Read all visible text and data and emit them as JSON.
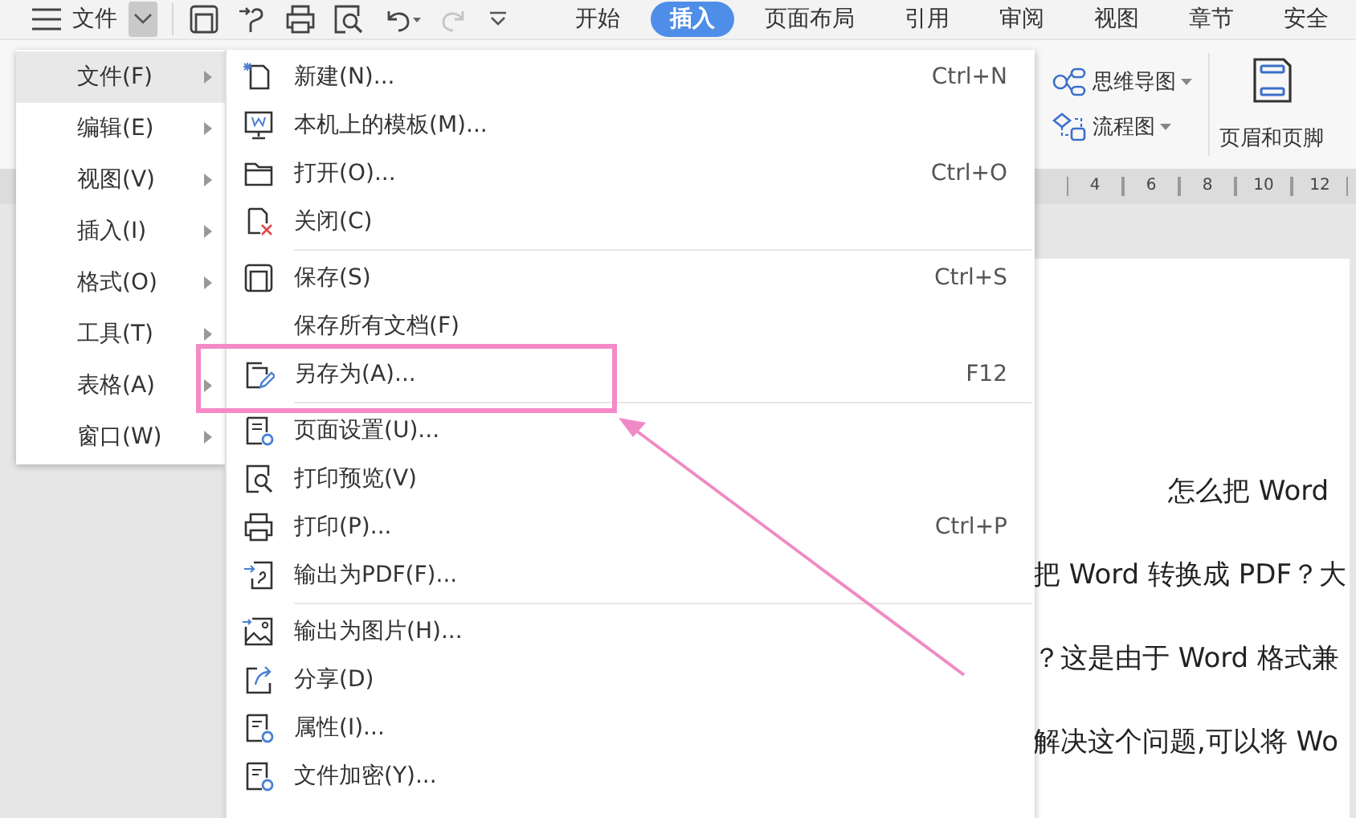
{
  "topbar": {
    "menu_label": "文件",
    "tabs": [
      {
        "label": "开始",
        "selected": false
      },
      {
        "label": "插入",
        "selected": true
      },
      {
        "label": "页面布局",
        "selected": false
      },
      {
        "label": "引用",
        "selected": false
      },
      {
        "label": "审阅",
        "selected": false
      },
      {
        "label": "视图",
        "selected": false
      },
      {
        "label": "章节",
        "selected": false
      },
      {
        "label": "安全",
        "selected": false
      }
    ],
    "redo_disabled": true
  },
  "ribbon": {
    "tools": [
      {
        "label": "思维导图"
      },
      {
        "label": "流程图"
      }
    ],
    "header_footer": "页眉和页脚"
  },
  "ruler": {
    "ticks": [
      "4",
      "6",
      "8",
      "10",
      "12"
    ]
  },
  "document": {
    "lines": [
      "怎么把 Word",
      "把 Word 转换成 PDF？大",
      "？这是由于 Word 格式兼",
      "解决这个问题,可以将 Wo"
    ]
  },
  "main_menu": {
    "items": [
      {
        "label": "文件(F)",
        "selected": true
      },
      {
        "label": "编辑(E)",
        "selected": false
      },
      {
        "label": "视图(V)",
        "selected": false
      },
      {
        "label": "插入(I)",
        "selected": false
      },
      {
        "label": "格式(O)",
        "selected": false
      },
      {
        "label": "工具(T)",
        "selected": false
      },
      {
        "label": "表格(A)",
        "selected": false
      },
      {
        "label": "窗口(W)",
        "selected": false
      }
    ]
  },
  "file_menu": {
    "items": [
      {
        "kind": "command",
        "label": "新建(N)...",
        "shortcut": "Ctrl+N"
      },
      {
        "kind": "command",
        "label": "本机上的模板(M)..."
      },
      {
        "kind": "command",
        "label": "打开(O)...",
        "shortcut": "Ctrl+O"
      },
      {
        "kind": "command",
        "label": "关闭(C)"
      },
      {
        "kind": "separator"
      },
      {
        "kind": "command",
        "label": "保存(S)",
        "shortcut": "Ctrl+S"
      },
      {
        "kind": "command",
        "label": "保存所有文档(F)"
      },
      {
        "kind": "command",
        "label": "另存为(A)...",
        "shortcut": "F12"
      },
      {
        "kind": "separator"
      },
      {
        "kind": "command",
        "label": "页面设置(U)..."
      },
      {
        "kind": "command",
        "label": "打印预览(V)"
      },
      {
        "kind": "command",
        "label": "打印(P)...",
        "shortcut": "Ctrl+P"
      },
      {
        "kind": "command",
        "label": "输出为PDF(F)..."
      },
      {
        "kind": "separator"
      },
      {
        "kind": "command",
        "label": "输出为图片(H)..."
      },
      {
        "kind": "command",
        "label": "分享(D)"
      },
      {
        "kind": "command",
        "label": "属性(I)..."
      },
      {
        "kind": "command",
        "label": "文件加密(Y)..."
      }
    ]
  }
}
